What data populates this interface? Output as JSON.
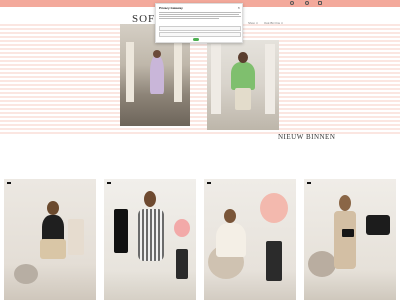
{
  "header": {
    "logo": "SOF",
    "nav": [
      "Shop ∨",
      "Ook Bij Ons ∨"
    ],
    "icons": [
      "user-icon",
      "search-icon",
      "cart-icon"
    ]
  },
  "modal": {
    "title": "Privacy Gateway",
    "close": "×"
  },
  "section": {
    "title": "NIEUW BINNEN"
  },
  "products": [
    {
      "badge": "",
      "name": ""
    },
    {
      "badge": "",
      "name": ""
    },
    {
      "badge": "",
      "name": ""
    },
    {
      "badge": "",
      "name": ""
    }
  ],
  "colors": {
    "topbar": "#f3a99b",
    "hero_stripe": "#fbe6e1",
    "toggle_on": "#4caf50"
  }
}
